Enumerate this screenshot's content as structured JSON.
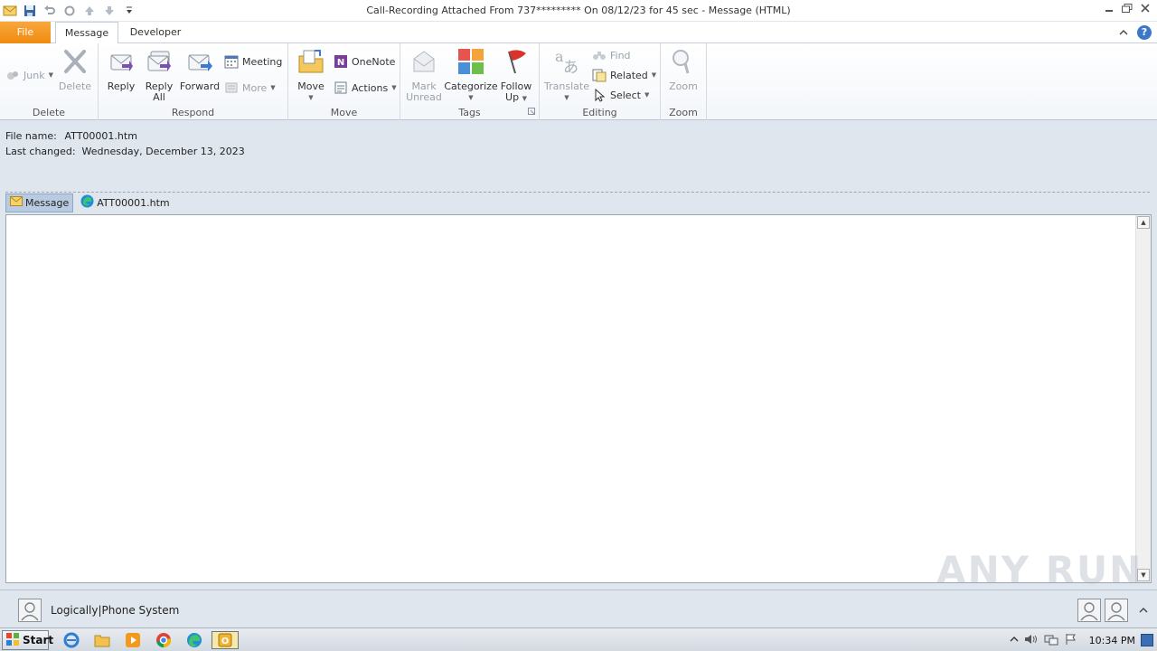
{
  "window": {
    "title": "Call-Recording Attached From 737********* On 08/12/23 for 45 sec -  Message (HTML)"
  },
  "tabs": {
    "file": "File",
    "message": "Message",
    "developer": "Developer"
  },
  "ribbon": {
    "delete_group": {
      "label": "Delete",
      "junk": "Junk",
      "delete": "Delete"
    },
    "respond_group": {
      "label": "Respond",
      "reply": "Reply",
      "reply_all_1": "Reply",
      "reply_all_2": "All",
      "forward": "Forward",
      "meeting": "Meeting",
      "more": "More"
    },
    "move_group": {
      "label": "Move",
      "move": "Move",
      "onenote": "OneNote",
      "actions": "Actions"
    },
    "tags_group": {
      "label": "Tags",
      "mark_unread_1": "Mark",
      "mark_unread_2": "Unread",
      "categorize": "Categorize",
      "follow_up_1": "Follow",
      "follow_up_2": "Up"
    },
    "editing_group": {
      "label": "Editing",
      "translate": "Translate",
      "find": "Find",
      "related": "Related",
      "select": "Select"
    },
    "zoom_group": {
      "label": "Zoom",
      "zoom": "Zoom"
    }
  },
  "header": {
    "file_name_label": "File name:",
    "file_name_value": "ATT00001.htm",
    "last_changed_label": "Last changed:",
    "last_changed_value": "Wednesday, December 13, 2023"
  },
  "attachments": {
    "message_label": "Message",
    "file_label": "ATT00001.htm"
  },
  "watermark": "ANY RUN",
  "people_pane": {
    "name": "Logically|Phone System"
  },
  "taskbar": {
    "start_label": "Start",
    "clock": "10:34 PM"
  },
  "colors": {
    "file_tab": "#f08a10",
    "help": "#3b78c8",
    "accent_flag": "#d9342b"
  }
}
